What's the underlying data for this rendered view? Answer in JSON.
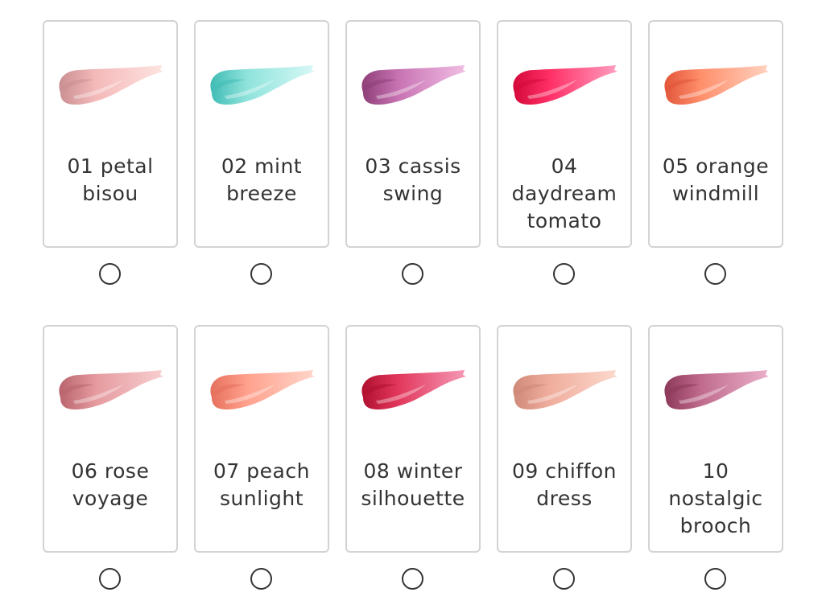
{
  "shades": [
    {
      "label": "01 petal bisou",
      "colors": {
        "dark": "#c98f92",
        "mid": "#f4b9b9",
        "light": "#fde4e1"
      }
    },
    {
      "label": "02 mint breeze",
      "colors": {
        "dark": "#3fbcb4",
        "mid": "#8fe3dc",
        "light": "#d8f8f6"
      }
    },
    {
      "label": "03 cassis swing",
      "colors": {
        "dark": "#8e3f78",
        "mid": "#c873b3",
        "light": "#f1bfe4"
      }
    },
    {
      "label": "04 daydream tomato",
      "colors": {
        "dark": "#d4093a",
        "mid": "#ff2f66",
        "light": "#ff9fc0"
      }
    },
    {
      "label": "05 orange windmill",
      "colors": {
        "dark": "#e2563a",
        "mid": "#ff8f6b",
        "light": "#ffd3c1"
      }
    },
    {
      "label": "06 rose voyage",
      "colors": {
        "dark": "#b9646d",
        "mid": "#e59a9f",
        "light": "#f8cfd0"
      }
    },
    {
      "label": "07 peach sunlight",
      "colors": {
        "dark": "#e5705c",
        "mid": "#ffa18d",
        "light": "#ffd6cb"
      }
    },
    {
      "label": "08 winter silhouette",
      "colors": {
        "dark": "#b0102f",
        "mid": "#e2375c",
        "light": "#f59ab7"
      }
    },
    {
      "label": "09 chiffon dress",
      "colors": {
        "dark": "#cf8979",
        "mid": "#f0ad9d",
        "light": "#fbd9cd"
      }
    },
    {
      "label": "10 nostalgic brooch",
      "colors": {
        "dark": "#8c3859",
        "mid": "#c06b8d",
        "light": "#eab0c9"
      }
    }
  ]
}
